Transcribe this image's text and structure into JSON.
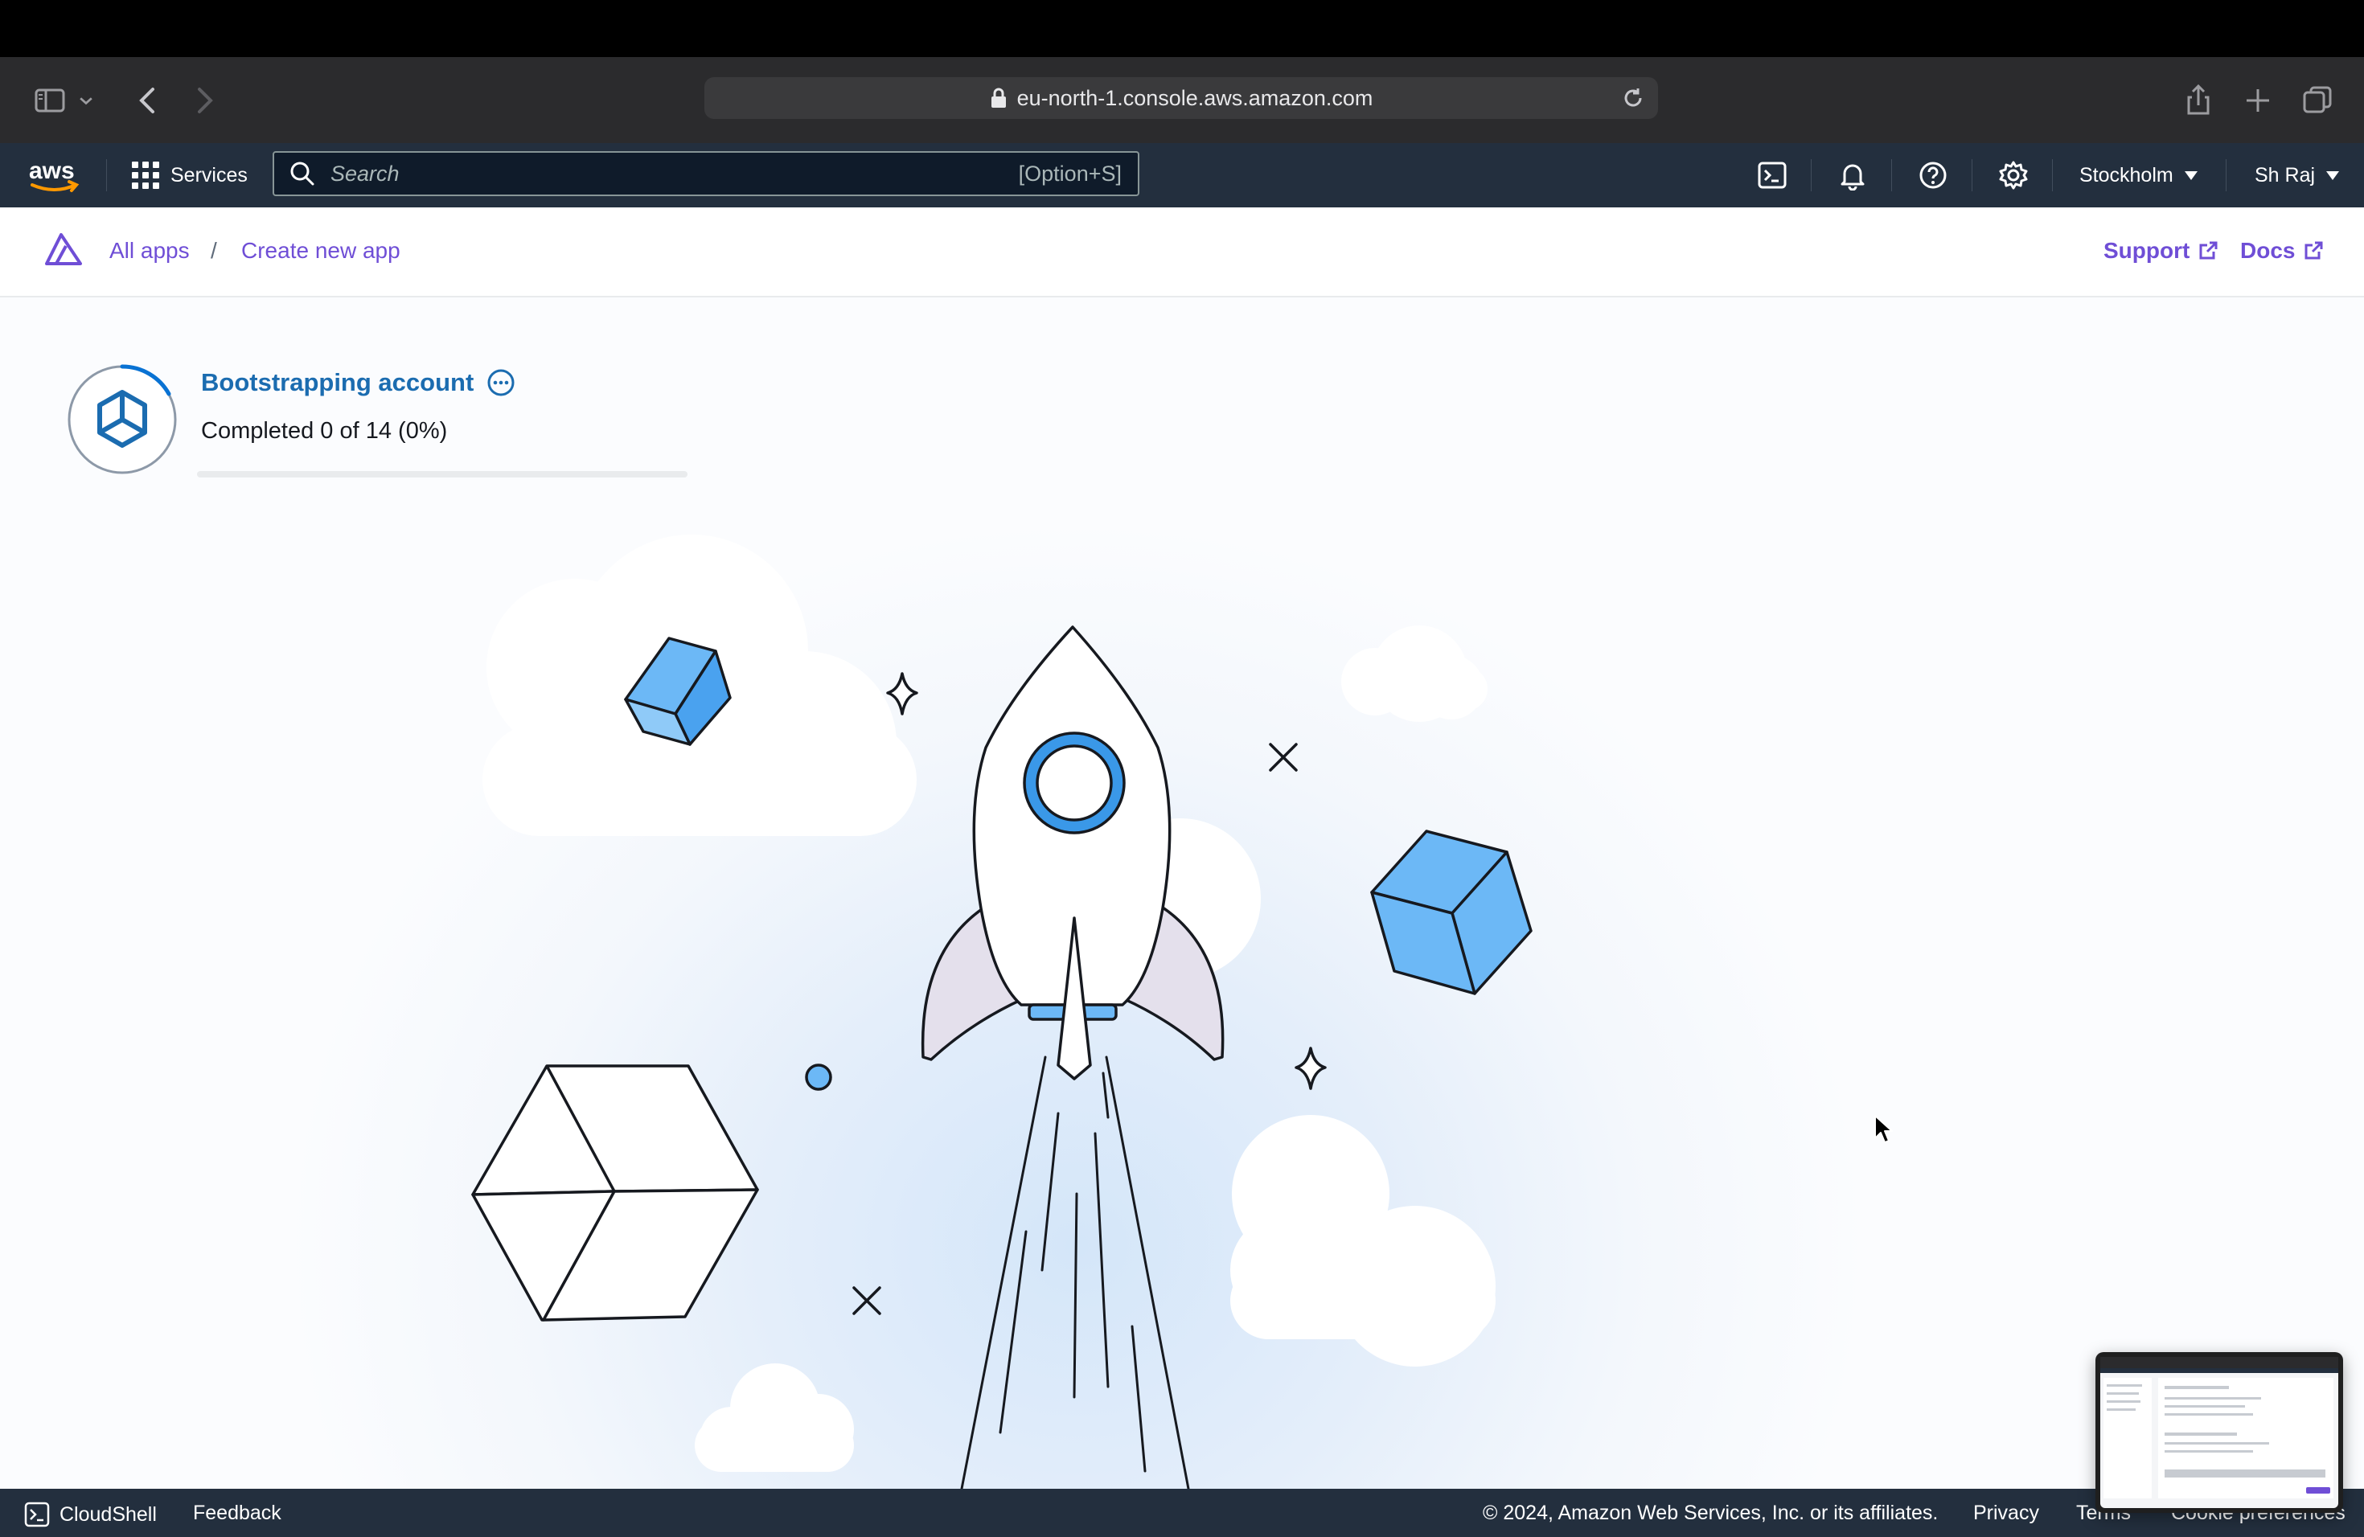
{
  "browser": {
    "url": "eu-north-1.console.aws.amazon.com"
  },
  "aws_nav": {
    "services_label": "Services",
    "search_placeholder": "Search",
    "search_shortcut": "[Option+S]",
    "region": "Stockholm",
    "user": "Sh Raj"
  },
  "app_header": {
    "breadcrumbs": [
      "All apps",
      "/",
      "Create new app"
    ],
    "support_label": "Support",
    "docs_label": "Docs"
  },
  "status": {
    "title": "Bootstrapping account",
    "progress_text": "Completed 0 of 14 (0%)",
    "progress_percent": 0
  },
  "footer": {
    "cloudshell_label": "CloudShell",
    "feedback_label": "Feedback",
    "copyright": "© 2024, Amazon Web Services, Inc. or its affiliates.",
    "privacy_label": "Privacy",
    "terms_label": "Terms",
    "cookie_label": "Cookie preferences"
  },
  "colors": {
    "aws_nav_bg": "#232f3e",
    "link_purple": "#6f4ed6",
    "status_blue": "#1b6cb0",
    "cube_blue": "#6cb8f6"
  }
}
